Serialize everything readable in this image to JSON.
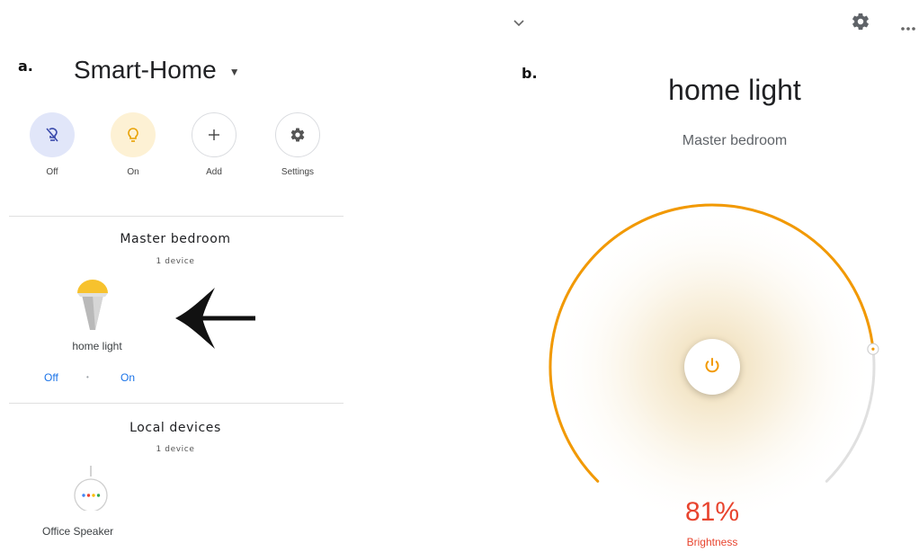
{
  "panel_a": {
    "label": "a.",
    "home_name": "Smart-Home",
    "chips": [
      {
        "label": "Off",
        "icon": "light-off-icon"
      },
      {
        "label": "On",
        "icon": "lightbulb-icon"
      },
      {
        "label": "Add",
        "icon": "plus-icon"
      },
      {
        "label": "Settings",
        "icon": "gear-icon"
      }
    ],
    "rooms": [
      {
        "name": "Master bedroom",
        "count": "1 device",
        "device": {
          "name": "home light",
          "icon": "bulb-icon",
          "off_label": "Off",
          "sep": "•",
          "on_label": "On"
        }
      },
      {
        "name": "Local devices",
        "count": "1 device",
        "device": {
          "name": "Office Speaker",
          "icon": "speaker-icon"
        }
      }
    ]
  },
  "panel_b": {
    "label": "b.",
    "device_name": "home light",
    "room": "Master bedroom",
    "brightness_value": 81,
    "brightness_text": "81%",
    "brightness_label": "Brightness",
    "accent": "#f29900",
    "value_color": "#e8442e"
  }
}
